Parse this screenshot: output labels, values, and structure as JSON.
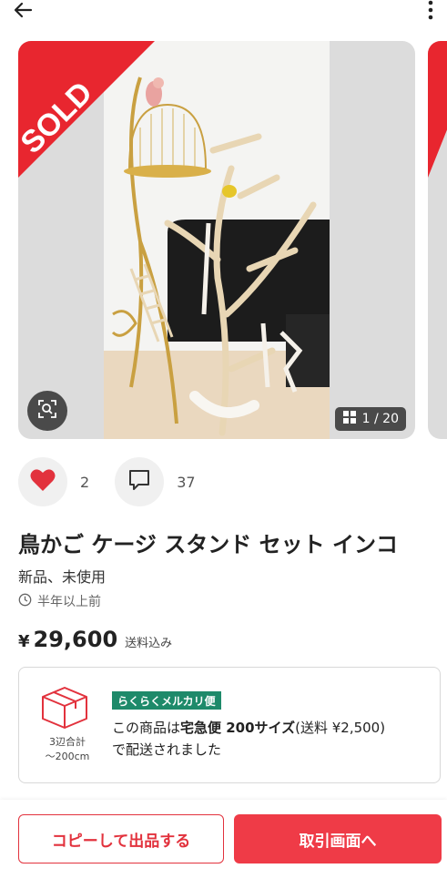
{
  "header": {
    "back_icon": "arrow-left-icon",
    "more_icon": "more-vertical-icon"
  },
  "gallery": {
    "sold_label": "SOLD",
    "counter_icon": "grid-icon",
    "counter": "1 / 20",
    "zoom_icon": "image-search-icon",
    "colors": {
      "sold": "#e8262f",
      "overlay": "#4a4a4a"
    }
  },
  "social": {
    "like_icon": "heart-icon",
    "like_count": "2",
    "comment_icon": "comment-icon",
    "comment_count": "37"
  },
  "item": {
    "title": "鳥かご ケージ スタンド セット インコ",
    "condition": "新品、未使用",
    "posted_icon": "clock-icon",
    "posted": "半年以上前",
    "price_symbol": "¥",
    "price": "29,600",
    "price_note": "送料込み"
  },
  "shipping": {
    "box_icon": "package-icon",
    "size_line1": "3辺合計",
    "size_line2": "～200cm",
    "badge": "らくらくメルカリ便",
    "text_prefix": "この商品は",
    "text_method": "宅急便 200サイズ",
    "text_fee": "(送料 ¥2,500)",
    "text_suffix": "で配送されました",
    "badge_color": "#1e8a6a"
  },
  "footer": {
    "copy_button": "コピーして出品する",
    "trade_button": "取引画面へ",
    "accent_color": "#ef3b47"
  }
}
